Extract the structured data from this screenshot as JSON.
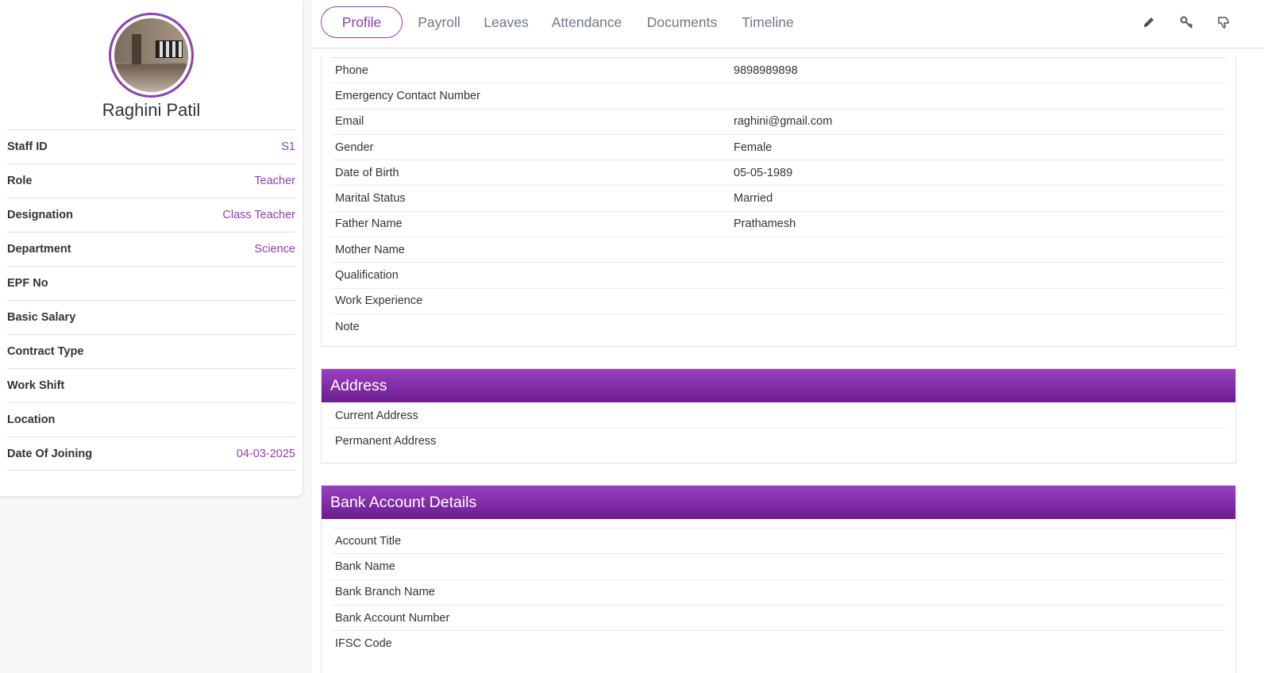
{
  "profile": {
    "name": "Raghini Patil",
    "rows": [
      {
        "label": "Staff ID",
        "value": "S1"
      },
      {
        "label": "Role",
        "value": "Teacher"
      },
      {
        "label": "Designation",
        "value": "Class Teacher"
      },
      {
        "label": "Department",
        "value": "Science"
      },
      {
        "label": "EPF No",
        "value": ""
      },
      {
        "label": "Basic Salary",
        "value": ""
      },
      {
        "label": "Contract Type",
        "value": ""
      },
      {
        "label": "Work Shift",
        "value": ""
      },
      {
        "label": "Location",
        "value": ""
      },
      {
        "label": "Date Of Joining",
        "value": "04-03-2025"
      }
    ]
  },
  "tabs": [
    {
      "label": "Profile",
      "active": true
    },
    {
      "label": "Payroll"
    },
    {
      "label": "Leaves"
    },
    {
      "label": "Attendance"
    },
    {
      "label": "Documents"
    },
    {
      "label": "Timeline"
    }
  ],
  "toolbar": {
    "icons": [
      "pencil-icon",
      "key-icon",
      "thumbs-down-icon"
    ]
  },
  "personal": {
    "rows": [
      {
        "label": "Phone",
        "value": "9898989898"
      },
      {
        "label": "Emergency Contact Number",
        "value": ""
      },
      {
        "label": "Email",
        "value": "raghini@gmail.com"
      },
      {
        "label": "Gender",
        "value": "Female"
      },
      {
        "label": "Date of Birth",
        "value": "05-05-1989"
      },
      {
        "label": "Marital Status",
        "value": "Married"
      },
      {
        "label": "Father Name",
        "value": "Prathamesh"
      },
      {
        "label": "Mother Name",
        "value": ""
      },
      {
        "label": "Qualification",
        "value": ""
      },
      {
        "label": "Work Experience",
        "value": ""
      },
      {
        "label": "Note",
        "value": ""
      }
    ]
  },
  "address": {
    "title": "Address",
    "rows": [
      {
        "label": "Current Address",
        "value": ""
      },
      {
        "label": "Permanent Address",
        "value": ""
      }
    ]
  },
  "bank": {
    "title": "Bank Account Details",
    "rows": [
      {
        "label": "Account Title",
        "value": ""
      },
      {
        "label": "Bank Name",
        "value": ""
      },
      {
        "label": "Bank Branch Name",
        "value": ""
      },
      {
        "label": "Bank Account Number",
        "value": ""
      },
      {
        "label": "IFSC Code",
        "value": ""
      }
    ]
  },
  "colors": {
    "accent": "#8e3fb0",
    "header_top": "#9b3fc2",
    "header_bottom": "#6a1d8e"
  }
}
